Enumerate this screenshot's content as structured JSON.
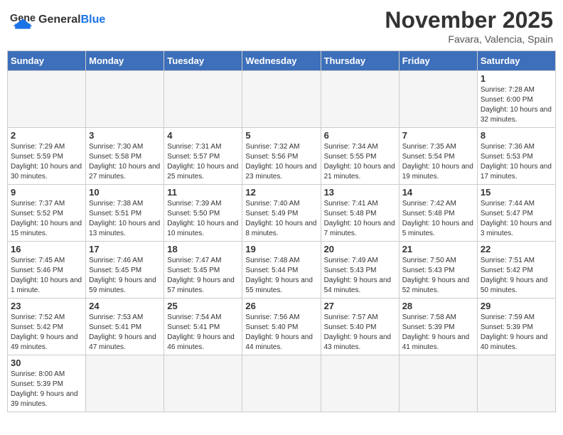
{
  "header": {
    "logo_general": "General",
    "logo_blue": "Blue",
    "month_title": "November 2025",
    "location": "Favara, Valencia, Spain"
  },
  "calendar": {
    "days_of_week": [
      "Sunday",
      "Monday",
      "Tuesday",
      "Wednesday",
      "Thursday",
      "Friday",
      "Saturday"
    ],
    "weeks": [
      {
        "days": [
          {
            "number": "",
            "info": "",
            "empty": true
          },
          {
            "number": "",
            "info": "",
            "empty": true
          },
          {
            "number": "",
            "info": "",
            "empty": true
          },
          {
            "number": "",
            "info": "",
            "empty": true
          },
          {
            "number": "",
            "info": "",
            "empty": true
          },
          {
            "number": "",
            "info": "",
            "empty": true
          },
          {
            "number": "1",
            "info": "Sunrise: 7:28 AM\nSunset: 6:00 PM\nDaylight: 10 hours and 32 minutes.",
            "empty": false
          }
        ]
      },
      {
        "days": [
          {
            "number": "2",
            "info": "Sunrise: 7:29 AM\nSunset: 5:59 PM\nDaylight: 10 hours and 30 minutes.",
            "empty": false
          },
          {
            "number": "3",
            "info": "Sunrise: 7:30 AM\nSunset: 5:58 PM\nDaylight: 10 hours and 27 minutes.",
            "empty": false
          },
          {
            "number": "4",
            "info": "Sunrise: 7:31 AM\nSunset: 5:57 PM\nDaylight: 10 hours and 25 minutes.",
            "empty": false
          },
          {
            "number": "5",
            "info": "Sunrise: 7:32 AM\nSunset: 5:56 PM\nDaylight: 10 hours and 23 minutes.",
            "empty": false
          },
          {
            "number": "6",
            "info": "Sunrise: 7:34 AM\nSunset: 5:55 PM\nDaylight: 10 hours and 21 minutes.",
            "empty": false
          },
          {
            "number": "7",
            "info": "Sunrise: 7:35 AM\nSunset: 5:54 PM\nDaylight: 10 hours and 19 minutes.",
            "empty": false
          },
          {
            "number": "8",
            "info": "Sunrise: 7:36 AM\nSunset: 5:53 PM\nDaylight: 10 hours and 17 minutes.",
            "empty": false
          }
        ]
      },
      {
        "days": [
          {
            "number": "9",
            "info": "Sunrise: 7:37 AM\nSunset: 5:52 PM\nDaylight: 10 hours and 15 minutes.",
            "empty": false
          },
          {
            "number": "10",
            "info": "Sunrise: 7:38 AM\nSunset: 5:51 PM\nDaylight: 10 hours and 13 minutes.",
            "empty": false
          },
          {
            "number": "11",
            "info": "Sunrise: 7:39 AM\nSunset: 5:50 PM\nDaylight: 10 hours and 10 minutes.",
            "empty": false
          },
          {
            "number": "12",
            "info": "Sunrise: 7:40 AM\nSunset: 5:49 PM\nDaylight: 10 hours and 8 minutes.",
            "empty": false
          },
          {
            "number": "13",
            "info": "Sunrise: 7:41 AM\nSunset: 5:48 PM\nDaylight: 10 hours and 7 minutes.",
            "empty": false
          },
          {
            "number": "14",
            "info": "Sunrise: 7:42 AM\nSunset: 5:48 PM\nDaylight: 10 hours and 5 minutes.",
            "empty": false
          },
          {
            "number": "15",
            "info": "Sunrise: 7:44 AM\nSunset: 5:47 PM\nDaylight: 10 hours and 3 minutes.",
            "empty": false
          }
        ]
      },
      {
        "days": [
          {
            "number": "16",
            "info": "Sunrise: 7:45 AM\nSunset: 5:46 PM\nDaylight: 10 hours and 1 minute.",
            "empty": false
          },
          {
            "number": "17",
            "info": "Sunrise: 7:46 AM\nSunset: 5:45 PM\nDaylight: 9 hours and 59 minutes.",
            "empty": false
          },
          {
            "number": "18",
            "info": "Sunrise: 7:47 AM\nSunset: 5:45 PM\nDaylight: 9 hours and 57 minutes.",
            "empty": false
          },
          {
            "number": "19",
            "info": "Sunrise: 7:48 AM\nSunset: 5:44 PM\nDaylight: 9 hours and 55 minutes.",
            "empty": false
          },
          {
            "number": "20",
            "info": "Sunrise: 7:49 AM\nSunset: 5:43 PM\nDaylight: 9 hours and 54 minutes.",
            "empty": false
          },
          {
            "number": "21",
            "info": "Sunrise: 7:50 AM\nSunset: 5:43 PM\nDaylight: 9 hours and 52 minutes.",
            "empty": false
          },
          {
            "number": "22",
            "info": "Sunrise: 7:51 AM\nSunset: 5:42 PM\nDaylight: 9 hours and 50 minutes.",
            "empty": false
          }
        ]
      },
      {
        "days": [
          {
            "number": "23",
            "info": "Sunrise: 7:52 AM\nSunset: 5:42 PM\nDaylight: 9 hours and 49 minutes.",
            "empty": false
          },
          {
            "number": "24",
            "info": "Sunrise: 7:53 AM\nSunset: 5:41 PM\nDaylight: 9 hours and 47 minutes.",
            "empty": false
          },
          {
            "number": "25",
            "info": "Sunrise: 7:54 AM\nSunset: 5:41 PM\nDaylight: 9 hours and 46 minutes.",
            "empty": false
          },
          {
            "number": "26",
            "info": "Sunrise: 7:56 AM\nSunset: 5:40 PM\nDaylight: 9 hours and 44 minutes.",
            "empty": false
          },
          {
            "number": "27",
            "info": "Sunrise: 7:57 AM\nSunset: 5:40 PM\nDaylight: 9 hours and 43 minutes.",
            "empty": false
          },
          {
            "number": "28",
            "info": "Sunrise: 7:58 AM\nSunset: 5:39 PM\nDaylight: 9 hours and 41 minutes.",
            "empty": false
          },
          {
            "number": "29",
            "info": "Sunrise: 7:59 AM\nSunset: 5:39 PM\nDaylight: 9 hours and 40 minutes.",
            "empty": false
          }
        ]
      },
      {
        "days": [
          {
            "number": "30",
            "info": "Sunrise: 8:00 AM\nSunset: 5:39 PM\nDaylight: 9 hours and 39 minutes.",
            "empty": false
          },
          {
            "number": "",
            "info": "",
            "empty": true
          },
          {
            "number": "",
            "info": "",
            "empty": true
          },
          {
            "number": "",
            "info": "",
            "empty": true
          },
          {
            "number": "",
            "info": "",
            "empty": true
          },
          {
            "number": "",
            "info": "",
            "empty": true
          },
          {
            "number": "",
            "info": "",
            "empty": true
          }
        ]
      }
    ]
  }
}
